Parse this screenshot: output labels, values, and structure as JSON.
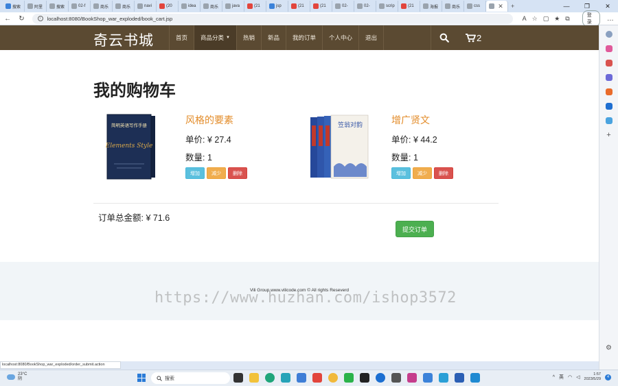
{
  "browser": {
    "tabs": [
      {
        "label": "搜索",
        "fav": "blue"
      },
      {
        "label": "阿里",
        "fav": "gray"
      },
      {
        "label": "搜索",
        "fav": "gray"
      },
      {
        "label": "02-f",
        "fav": "gray"
      },
      {
        "label": "商乐",
        "fav": "gray"
      },
      {
        "label": "商乐",
        "fav": "gray"
      },
      {
        "label": "navi",
        "fav": "gray"
      },
      {
        "label": "(20",
        "fav": "red"
      },
      {
        "label": "idea",
        "fav": "gray"
      },
      {
        "label": "商乐",
        "fav": "gray"
      },
      {
        "label": "java",
        "fav": "gray"
      },
      {
        "label": "(21",
        "fav": "red"
      },
      {
        "label": "jsp",
        "fav": "blue"
      },
      {
        "label": "(21",
        "fav": "red"
      },
      {
        "label": "(21",
        "fav": "red"
      },
      {
        "label": "02-",
        "fav": "gray"
      },
      {
        "label": "02-",
        "fav": "gray"
      },
      {
        "label": "scrip",
        "fav": "gray"
      },
      {
        "label": "(21",
        "fav": "red"
      },
      {
        "label": "海报",
        "fav": "gray"
      },
      {
        "label": "商乐",
        "fav": "gray"
      },
      {
        "label": "css",
        "fav": "gray"
      },
      {
        "label": " ",
        "fav": "gray",
        "active": true
      }
    ],
    "new_tab": "+",
    "url": "localhost:8080/BookShop_war_exploded/book_cart.jsp",
    "login_label": "登录",
    "window_controls": [
      "—",
      "❐",
      "✕"
    ],
    "status_url": "localhost:8080/BookShop_war_exploded/order_submit.action"
  },
  "site": {
    "brand": "奇云书城",
    "nav": [
      {
        "label": "首页",
        "key": "home"
      },
      {
        "label": "商品分类",
        "key": "category",
        "dropdown": true
      },
      {
        "label": "热销",
        "key": "hot"
      },
      {
        "label": "新品",
        "key": "new"
      },
      {
        "label": "我的订单",
        "key": "orders"
      },
      {
        "label": "个人中心",
        "key": "profile"
      },
      {
        "label": "退出",
        "key": "logout"
      }
    ],
    "cart_count": "2"
  },
  "cart": {
    "title": "我的购物车",
    "items": [
      {
        "name": "风格的要素",
        "price": "单价: ¥ 27.4",
        "qty": "数量: 1",
        "cover_title": "简明英语写作手册",
        "cover_sub": "Elements Style",
        "add": "增加",
        "reduce": "减少",
        "remove": "删除"
      },
      {
        "name": "增广贤文",
        "price": "单价: ¥ 44.2",
        "qty": "数量: 1",
        "cover_title": "笠翁对韵",
        "add": "增加",
        "reduce": "减少",
        "remove": "删除"
      }
    ],
    "total": "订单总金额: ¥ 71.6",
    "submit": "提交订单"
  },
  "footer": {
    "copyright": "Vili Group www.vilicode.com © All rights Reseverd",
    "watermark": "https://www.huzhan.com/ishop3572"
  },
  "taskbar": {
    "weather_temp": "23°C",
    "weather_cond": "阴",
    "search": "搜索",
    "lang": "英",
    "time": "1:57",
    "date": "2023/5/29",
    "notifications": "4"
  },
  "colors": {
    "nav_bg": "#5b4a32",
    "title_accent": "#e38c2a",
    "submit_bg": "#4caf50"
  }
}
